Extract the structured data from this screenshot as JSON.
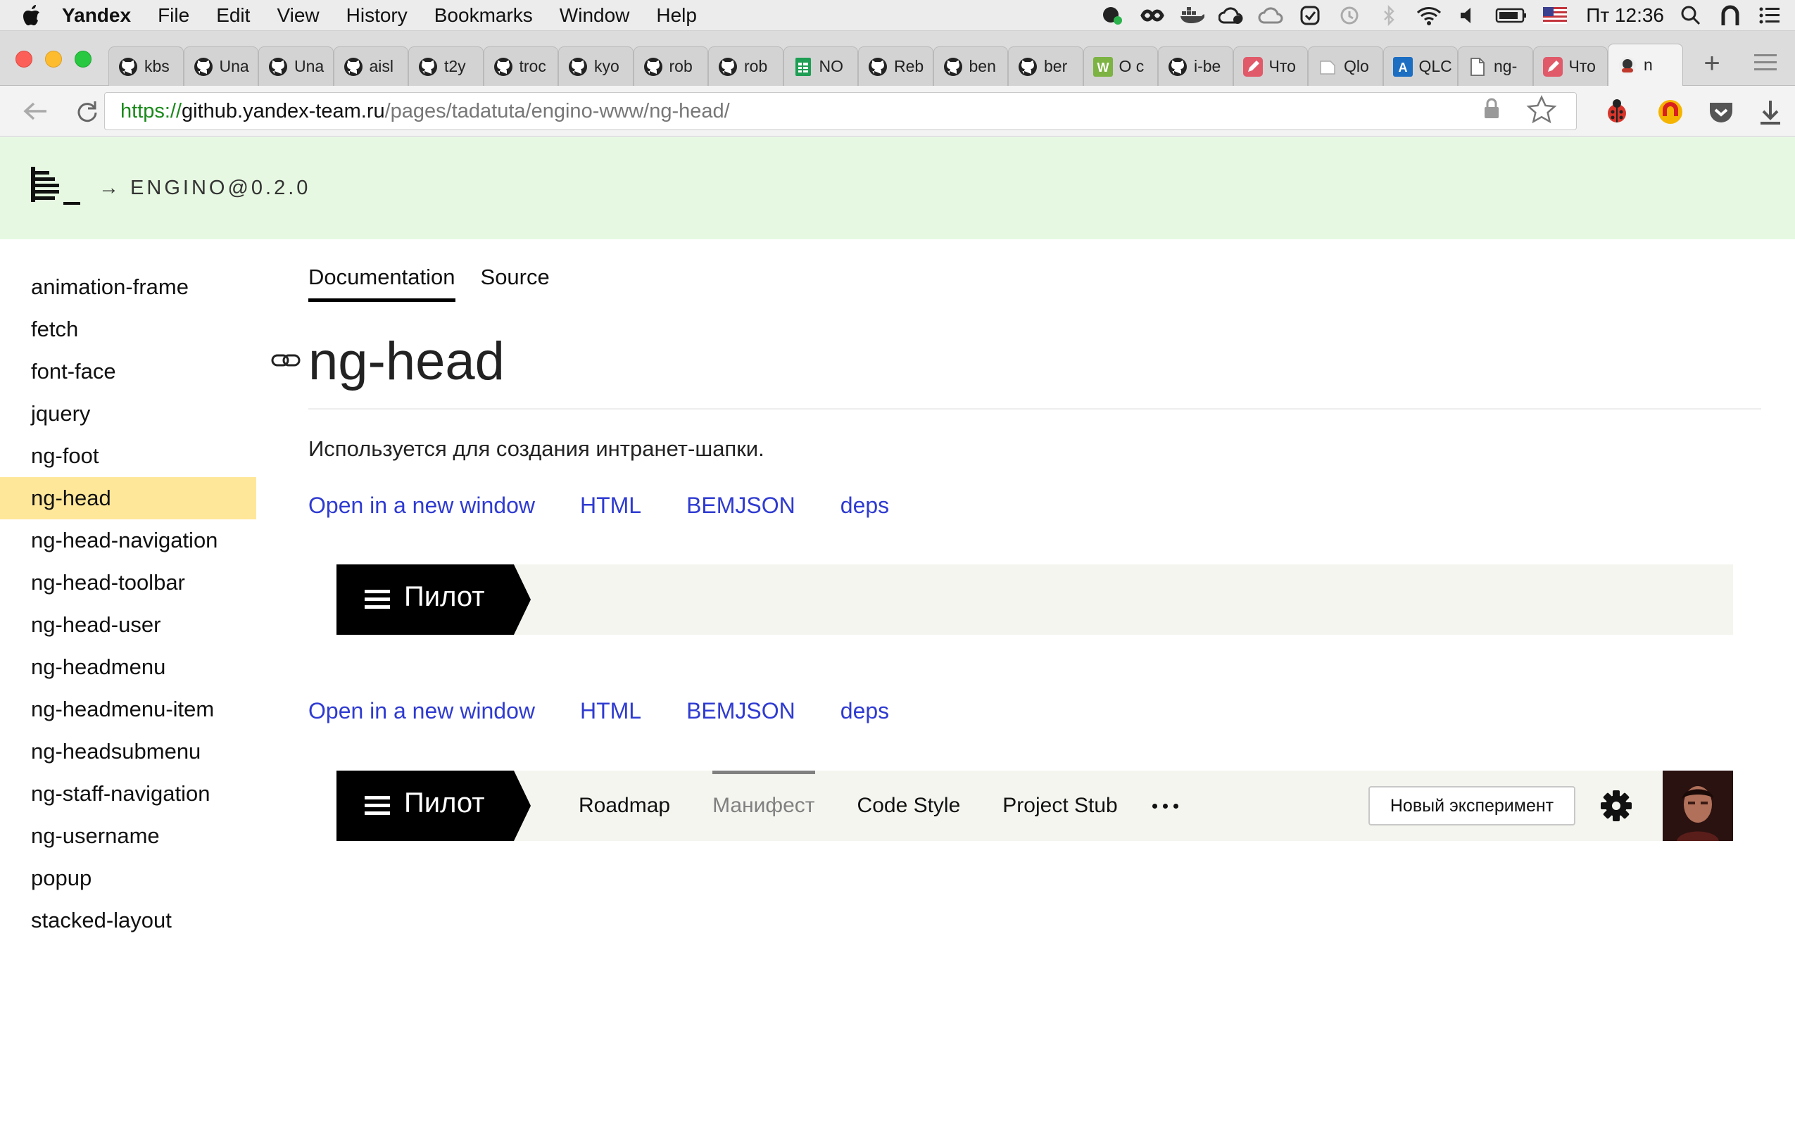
{
  "os_menubar": {
    "app_name": "Yandex",
    "menus": [
      "File",
      "Edit",
      "View",
      "History",
      "Bookmarks",
      "Window",
      "Help"
    ],
    "clock": "Пт 12:36"
  },
  "browser": {
    "tabs": [
      {
        "icon": "github-icon",
        "label": "kbs"
      },
      {
        "icon": "github-icon",
        "label": "Una"
      },
      {
        "icon": "github-icon",
        "label": "Una"
      },
      {
        "icon": "github-icon",
        "label": "aisl"
      },
      {
        "icon": "github-icon",
        "label": "t2y"
      },
      {
        "icon": "github-icon",
        "label": "troc"
      },
      {
        "icon": "github-icon",
        "label": "kyo"
      },
      {
        "icon": "github-icon",
        "label": "rob"
      },
      {
        "icon": "github-icon",
        "label": "rob"
      },
      {
        "icon": "sheets-icon",
        "label": "NO"
      },
      {
        "icon": "github-icon",
        "label": "Reb"
      },
      {
        "icon": "github-icon",
        "label": "ben"
      },
      {
        "icon": "github-icon",
        "label": "ber"
      },
      {
        "icon": "w-icon",
        "label": "О с"
      },
      {
        "icon": "github-icon",
        "label": "i-be"
      },
      {
        "icon": "pencil-icon",
        "label": "Что"
      },
      {
        "icon": "blank-page-icon",
        "label": "Qlo"
      },
      {
        "icon": "a-icon",
        "label": "QLC"
      },
      {
        "icon": "document-icon",
        "label": "ng-"
      },
      {
        "icon": "pencil-icon",
        "label": "Что"
      },
      {
        "icon": "octocat-icon",
        "label": "n"
      }
    ],
    "url": {
      "scheme": "https://",
      "host": "github.yandex-team.ru",
      "path": "/pages/tadatuta/engino-www/ng-head/"
    }
  },
  "site": {
    "version": "→ ENGINO@0.2.0"
  },
  "sidebar": {
    "items": [
      "animation-frame",
      "fetch",
      "font-face",
      "jquery",
      "ng-foot",
      "ng-head",
      "ng-head-navigation",
      "ng-head-toolbar",
      "ng-head-user",
      "ng-headmenu",
      "ng-headmenu-item",
      "ng-headsubmenu",
      "ng-staff-navigation",
      "ng-username",
      "popup",
      "stacked-layout"
    ],
    "active": "ng-head"
  },
  "main": {
    "tabs": [
      "Documentation",
      "Source"
    ],
    "active_tab": "Documentation",
    "title": "ng-head",
    "description": "Используется для создания интранет-шапки.",
    "example_links": [
      "Open in a new window",
      "HTML",
      "BEMJSON",
      "deps"
    ]
  },
  "example1": {
    "brand": "Пилот"
  },
  "example2": {
    "brand": "Пилот",
    "nav": [
      "Roadmap",
      "Манифест",
      "Code Style",
      "Project Stub"
    ],
    "current_nav": "Манифест",
    "button": "Новый эксперимент"
  },
  "colors": {
    "header_bg": "#e6f8e1",
    "sidebar_active": "#ffe79a",
    "link": "#2f3bd1",
    "example_bg": "#f5f5f0",
    "pilot_bg": "#000000"
  }
}
